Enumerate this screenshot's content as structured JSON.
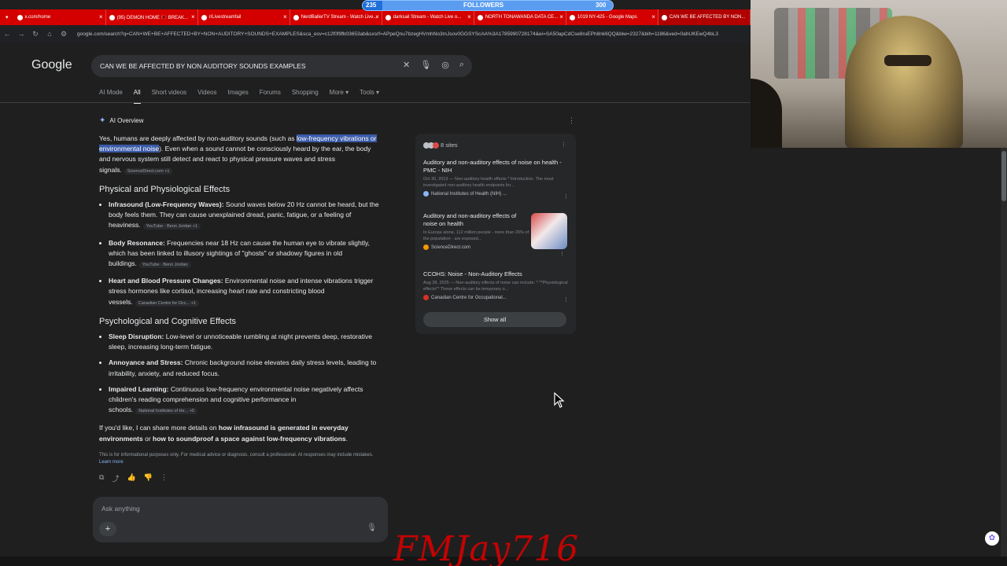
{
  "tabs": [
    {
      "label": "x.com/home"
    },
    {
      "label": "(95) DEMON HOME 🇦🇱 BREAK..."
    },
    {
      "label": "r/Livestreamfail"
    },
    {
      "label": "NerdBallerTV Stream - Watch Live..."
    },
    {
      "label": "darksail Stream - Watch Live o..."
    },
    {
      "label": "NORTH TONAWANDA DATA CE..."
    },
    {
      "label": "1019 NY-425 - Google Maps"
    },
    {
      "label": "CAN WE BE AFFECTED BY NON..."
    }
  ],
  "followers": {
    "current": "235",
    "label": "FOLLOWERS",
    "goal": "300",
    "progress": 0.08
  },
  "url": "google.com/search?q=CAN+WE+BE+AFFECTED+BY+NON+AUDITORY+SOUNDS+EXAMPLES&sca_esv=c12f0f9fb03653ab&sxsrf=APpeQnu7bzegHVmhNo3mJsov0GGSYScAA%3A1785990728174&ei=SA50apCdCse8ruEPh8nk6QQ&biw=2327&bih=1186&ved=0ahUKEwQ4bL3",
  "google": {
    "logo": "Google",
    "query": "CAN WE BE AFFECTED BY NON AUDITORY SOUNDS EXAMPLES",
    "nav": [
      "AI Mode",
      "All",
      "Short videos",
      "Videos",
      "Images",
      "Forums",
      "Shopping",
      "More ▾",
      "Tools ▾"
    ]
  },
  "aio": {
    "title": "AI Overview",
    "intro_pre": "Yes, humans are deeply affected by non-auditory sounds (such as ",
    "intro_hl": "low-frequency vibrations or environmental noise",
    "intro_post": "). Even when a sound cannot be consciously heard by the ear, the body and nervous system still detect and react to physical pressure waves and stress signals.",
    "intro_src": "ScienceDirect.com +1",
    "section1": "Physical and Physiological Effects",
    "s1": [
      {
        "bold": "Infrasound (Low-Frequency Waves):",
        "text": " Sound waves below 20 Hz cannot be heard, but the body feels them. They can cause unexplained dread, panic, fatigue, or a feeling of heaviness.",
        "src": "YouTube · Benn Jordan +1"
      },
      {
        "bold": "Body Resonance:",
        "text": " Frequencies near 18 Hz can cause the human eye to vibrate slightly, which has been linked to illusory sightings of \"ghosts\" or shadowy figures in old buildings.",
        "src": "YouTube · Benn Jordan"
      },
      {
        "bold": "Heart and Blood Pressure Changes:",
        "text": " Environmental noise and intense vibrations trigger stress hormones like cortisol, increasing heart rate and constricting blood vessels.",
        "src": "Canadian Centre for Occ... +1"
      }
    ],
    "section2": "Psychological and Cognitive Effects",
    "s2": [
      {
        "bold": "Sleep Disruption:",
        "text": " Low-level or unnoticeable rumbling at night prevents deep, restorative sleep, increasing long-term fatigue.",
        "src": ""
      },
      {
        "bold": "Annoyance and Stress:",
        "text": " Chronic background noise elevates daily stress levels, leading to irritability, anxiety, and reduced focus.",
        "src": ""
      },
      {
        "bold": "Impaired Learning:",
        "text": " Continuous low-frequency environmental noise negatively affects children's reading comprehension and cognitive performance in schools.",
        "src": "National Institutes of He... +5"
      }
    ],
    "outro_pre": "If you'd like, I can share more details on ",
    "outro_b1": "how infrasound is generated in everyday environments",
    "outro_mid": " or ",
    "outro_b2": "how to soundproof a space against low-frequency vibrations",
    "outro_post": ".",
    "disclaimer": "This is for informational purposes only. For medical advice or diagnosis, consult a professional. AI responses may include mistakes.",
    "learn_more": "Learn more",
    "ask_placeholder": "Ask anything"
  },
  "sources": {
    "count": "8 sites",
    "items": [
      {
        "title": "Auditory and non-auditory effects of noise on health - PMC - NIH",
        "snippet": "Oct 30, 2013 — Non-auditory health effects * Introduction. The most investigated non-auditory health endpoints for...",
        "source": "National Institutes of Health (NIH) ..."
      },
      {
        "title": "Auditory and non-auditory effects of noise on health",
        "snippet": "In Europe alone, 112 million people - more than 20% of the population - are exposed...",
        "source": "ScienceDirect.com"
      },
      {
        "title": "CCOHS: Noise - Non-Auditory Effects",
        "snippet": "Aug 28, 2025 — Non-auditory effects of noise can include: * **Physiological effects** These effects can be temporary o...",
        "source": "Canadian Centre for Occupational..."
      }
    ],
    "show_all": "Show all"
  },
  "watermark": "FMJay716"
}
